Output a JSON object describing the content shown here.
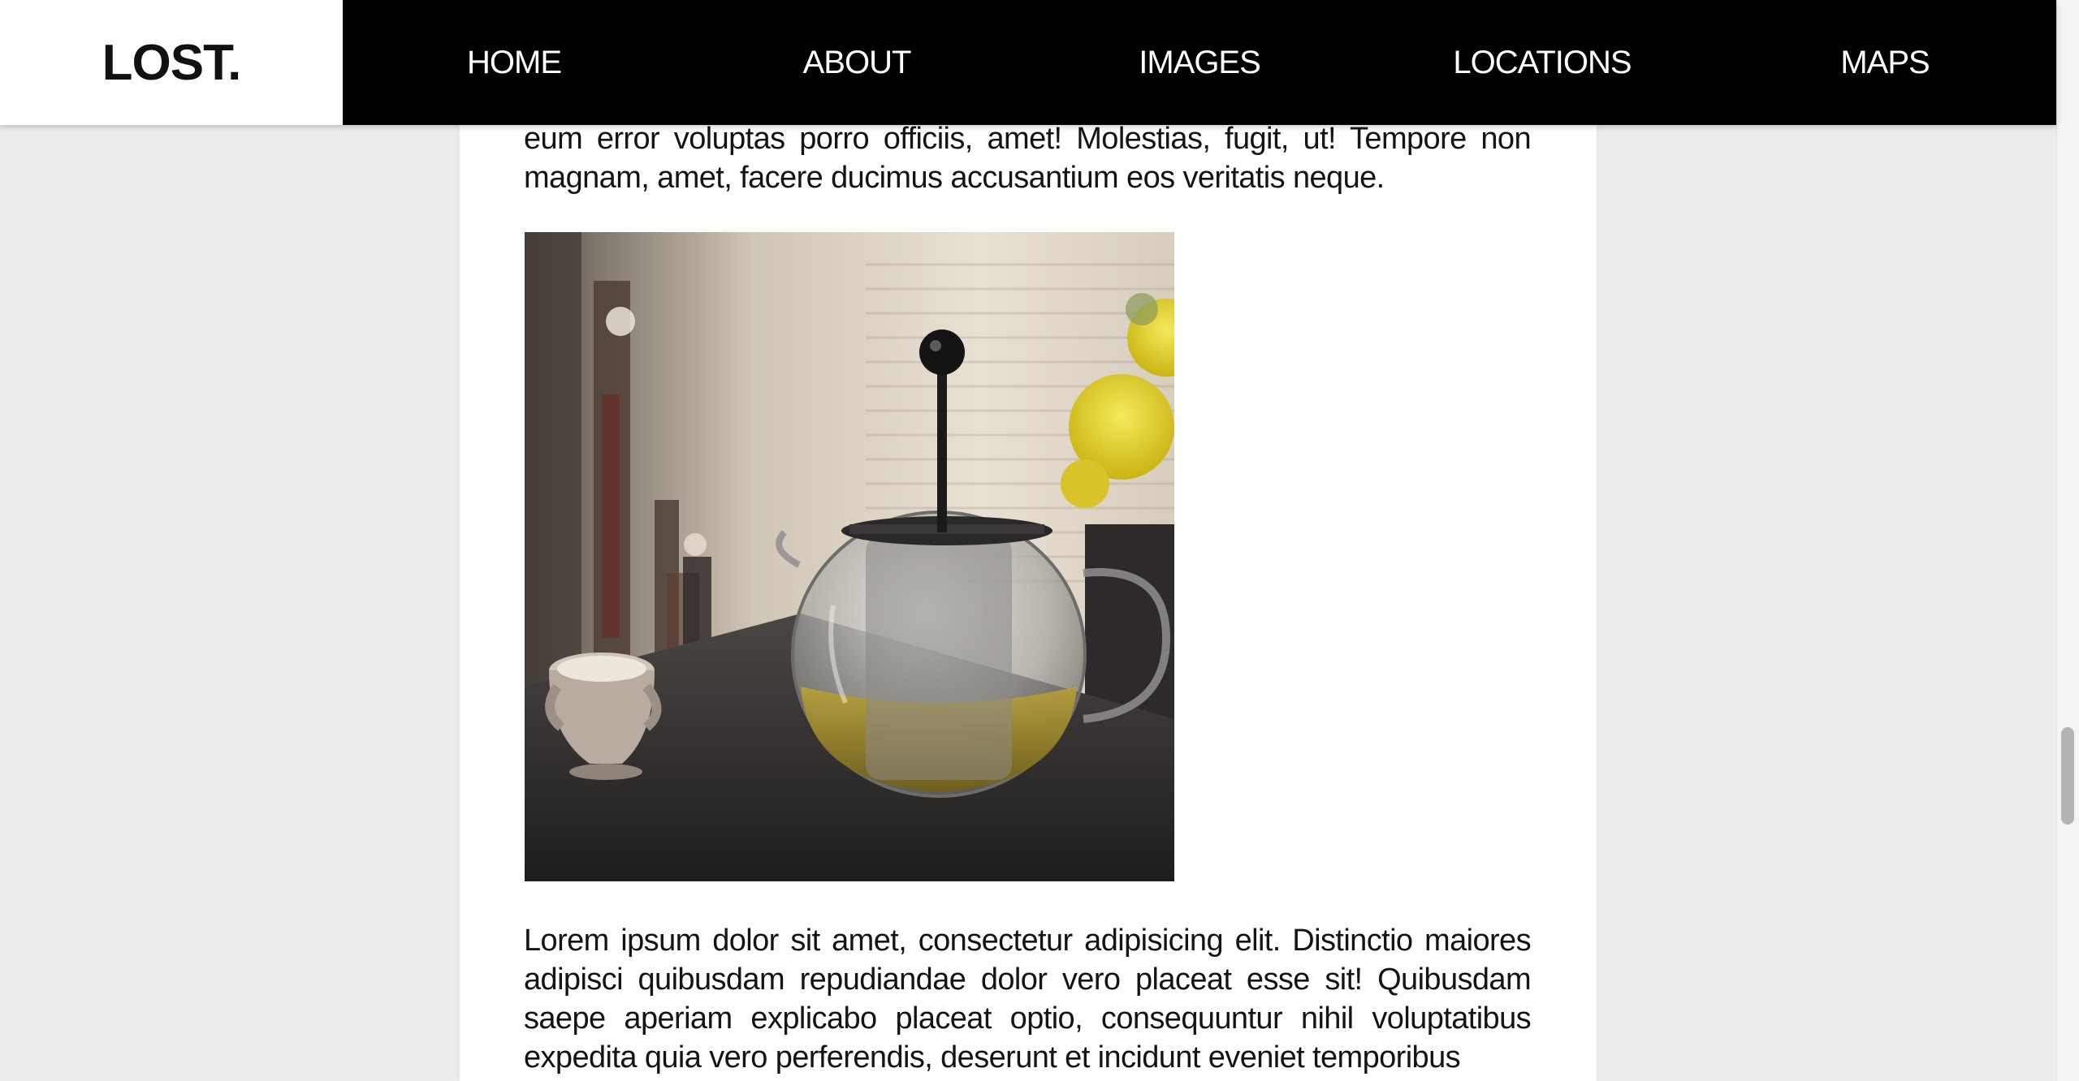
{
  "header": {
    "logo": "LOST.",
    "nav": [
      "HOME",
      "ABOUT",
      "IMAGES",
      "LOCATIONS",
      "MAPS"
    ]
  },
  "article": {
    "paragraph_top": "eum error voluptas porro officiis, amet! Molestias, fugit, ut! Tempore non magnam, amet, facere ducimus accusantium eos veritatis neque.",
    "paragraph_bottom": "Lorem ipsum dolor sit amet, consectetur adipisicing elit. Distinctio maiores adipisci quibusdam repudiandae dolor vero placeat esse sit! Quibusdam saepe aperiam explicabo placeat optio, consequuntur nihil voluptatibus expedita quia vero perferendis, deserunt et incidunt eveniet temporibus"
  },
  "colors": {
    "header_bg": "#000000",
    "logo_bg": "#ffffff",
    "page_bg": "#ececec",
    "content_bg": "#ffffff",
    "text": "#141414"
  }
}
